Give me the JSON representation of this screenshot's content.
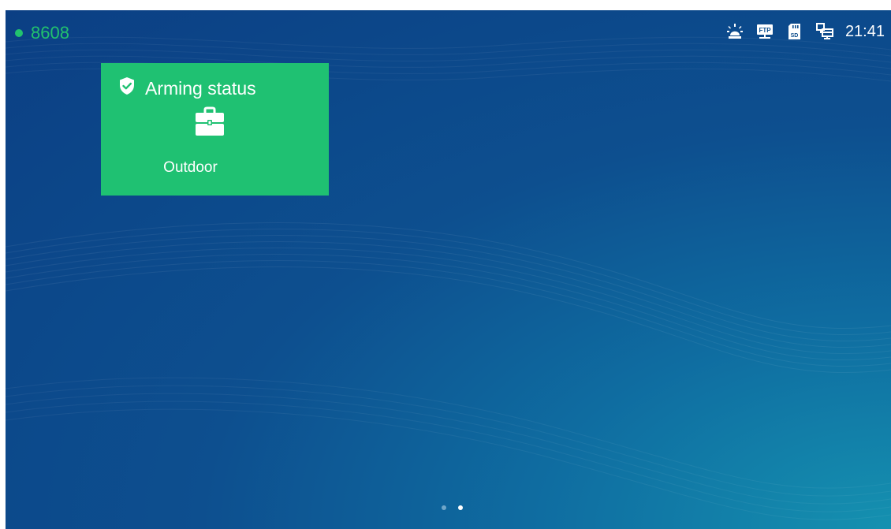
{
  "status_bar": {
    "extension": "8608",
    "extension_color": "#22c26e",
    "icons": [
      "alarm-light-icon",
      "ftp-icon",
      "sd-card-icon",
      "network-icon"
    ],
    "time": "21:41"
  },
  "widget": {
    "title": "Arming status",
    "mode_label": "Outdoor",
    "header_icon": "shield-check-icon",
    "mode_icon": "briefcase-icon",
    "background_color": "#1fc172"
  },
  "pager": {
    "pages": 2,
    "active_page": 2,
    "active_color": "#ffffff",
    "inactive_color": "#6fa6c9"
  }
}
